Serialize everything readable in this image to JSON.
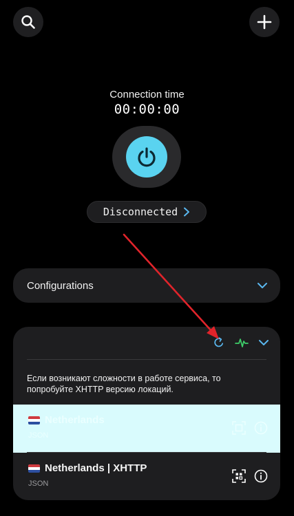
{
  "header": {
    "search_icon": "search-icon",
    "add_icon": "plus-icon"
  },
  "connection": {
    "label": "Connection time",
    "timer": "00:00:00",
    "status": "Disconnected",
    "power_color": "#5ad3f0"
  },
  "configurations": {
    "title": "Configurations"
  },
  "servers": {
    "notice": "Если возникают сложности в работе сервиса, то попробуйте XHTTP версию локаций.",
    "toolbar_icons": [
      "refresh-icon",
      "ping-icon",
      "chevron-down-icon"
    ],
    "items": [
      {
        "name": "Netherlands",
        "type": "JSON",
        "selected": true
      },
      {
        "name": "Netherlands | XHTTP",
        "type": "JSON",
        "selected": false
      }
    ],
    "selected_bg": "#d9fbfd",
    "accent": "#5ab8f0",
    "ping_color": "#3ecf6a"
  }
}
